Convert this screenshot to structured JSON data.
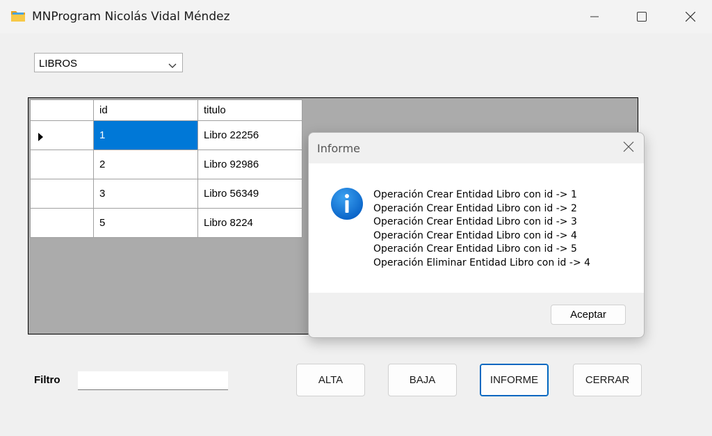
{
  "window": {
    "title": "MNProgram Nicolás Vidal Méndez",
    "icon": "folder-icon"
  },
  "entity_selector": {
    "selected": "LIBROS"
  },
  "grid": {
    "columns": [
      "id",
      "titulo"
    ],
    "rows": [
      {
        "id": "1",
        "titulo": "Libro 22256",
        "current": true
      },
      {
        "id": "2",
        "titulo": "Libro 92986"
      },
      {
        "id": "3",
        "titulo": "Libro 56349"
      },
      {
        "id": "5",
        "titulo": "Libro 8224"
      }
    ]
  },
  "filter": {
    "label": "Filtro",
    "value": ""
  },
  "buttons": {
    "alta": "ALTA",
    "baja": "BAJA",
    "informe": "INFORME",
    "cerrar": "CERRAR"
  },
  "dialog": {
    "title": "Informe",
    "icon": "info-icon",
    "lines": [
      "Operación Crear Entidad Libro con id -> 1",
      "Operación Crear Entidad Libro con id -> 2",
      "Operación Crear Entidad Libro con id -> 3",
      "Operación Crear Entidad Libro con id -> 4",
      "Operación Crear Entidad Libro con id -> 5",
      "Operación Eliminar Entidad Libro con id -> 4"
    ],
    "ok_label": "Aceptar"
  },
  "colors": {
    "selection": "#0078d7",
    "focus_border": "#0067c0",
    "grid_background": "#ababab"
  }
}
